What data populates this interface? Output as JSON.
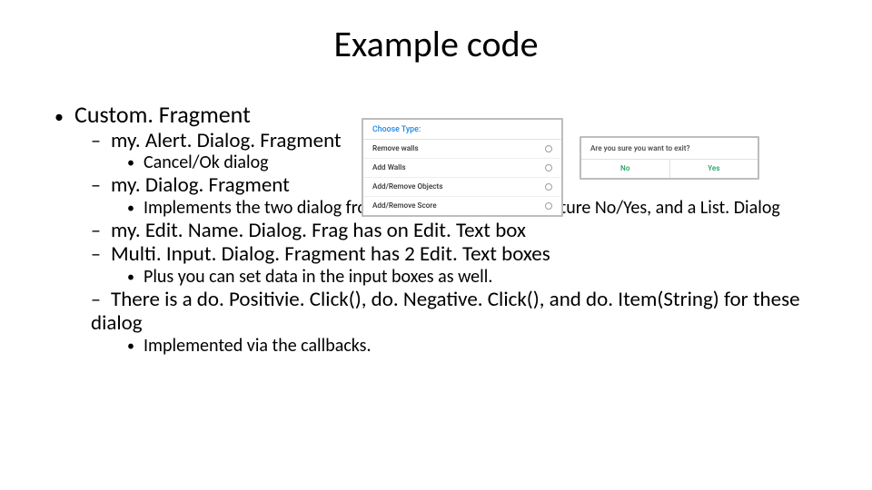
{
  "title": "Example code",
  "outline": {
    "l1": "Custom. Fragment",
    "l2a": "my. Alert. Dialog. Fragment",
    "l3a": "Cancel/Ok dialog",
    "l2b": "my. Dialog. Fragment",
    "l3b": "Implements the two dialog from the beginning of the lecture No/Yes, and a List. Dialog",
    "l2c": "my. Edit. Name. Dialog. Frag has on Edit. Text box",
    "l2d": "Multi. Input. Dialog. Fragment has 2 Edit. Text boxes",
    "l3d": "Plus you can set data in the input boxes as well.",
    "l2e": "There is a do. Positivie. Click(), do. Negative. Click(), and do. Item(String) for these dialog",
    "l3e": "Implemented via the callbacks."
  },
  "mock_list": {
    "header": "Choose Type:",
    "items": [
      "Remove walls",
      "Add Walls",
      "Add/Remove Objects",
      "Add/Remove Score"
    ]
  },
  "mock_yn": {
    "msg": "Are you sure you want to exit?",
    "no": "No",
    "yes": "Yes"
  }
}
